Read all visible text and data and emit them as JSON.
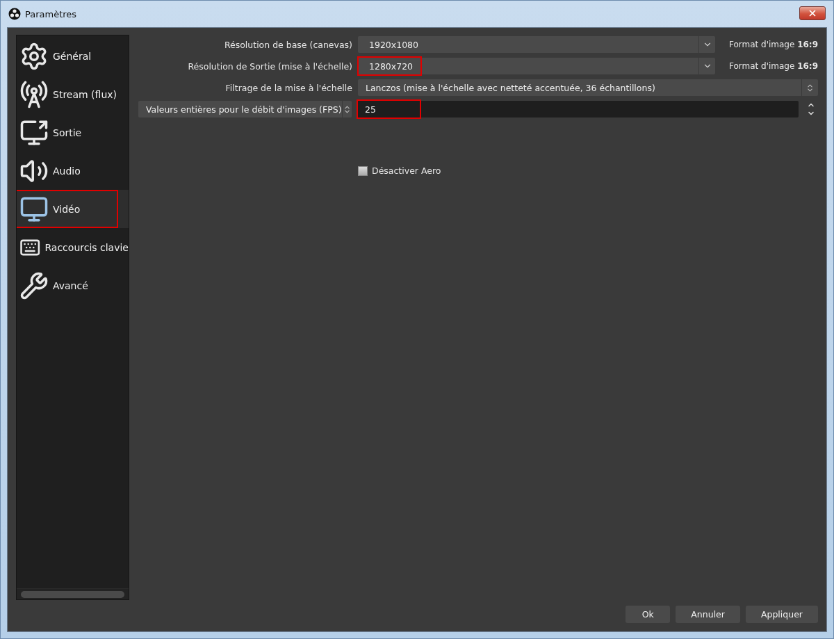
{
  "window": {
    "title": "Paramètres"
  },
  "sidebar": {
    "items": [
      {
        "label": "Général",
        "kind": "gear",
        "selected": false,
        "highlighted": false
      },
      {
        "label": "Stream (flux)",
        "kind": "antenna",
        "selected": false,
        "highlighted": false
      },
      {
        "label": "Sortie",
        "kind": "output",
        "selected": false,
        "highlighted": false
      },
      {
        "label": "Audio",
        "kind": "speaker",
        "selected": false,
        "highlighted": false
      },
      {
        "label": "Vidéo",
        "kind": "monitor",
        "selected": true,
        "highlighted": true
      },
      {
        "label": "Raccourcis clavie",
        "kind": "keyboard",
        "selected": false,
        "highlighted": false
      },
      {
        "label": "Avancé",
        "kind": "tools",
        "selected": false,
        "highlighted": false
      }
    ]
  },
  "form": {
    "rows": [
      {
        "kind": "combo",
        "label": "Résolution de base (canevas)",
        "value": "1920x1080",
        "aspect": "Format d'image **16:9**",
        "highlighted": false
      },
      {
        "kind": "combo",
        "label": "Résolution de Sortie (mise à l'échelle)",
        "value": "1280x720",
        "aspect": "Format d'image **16:9**",
        "highlighted": true
      },
      {
        "kind": "select",
        "label": "Filtrage de la mise à l'échelle",
        "value": "Lanczos (mise à l'échelle avec netteté accentuée, 36 échantillons)",
        "highlighted": false
      },
      {
        "kind": "spin",
        "label": "Valeurs entières pour le débit d'images (FPS)",
        "value": "25",
        "highlighted": true
      }
    ],
    "checkbox": {
      "label": "Désactiver Aero",
      "checked": false
    }
  },
  "buttons": [
    "Ok",
    "Annuler",
    "Appliquer"
  ]
}
